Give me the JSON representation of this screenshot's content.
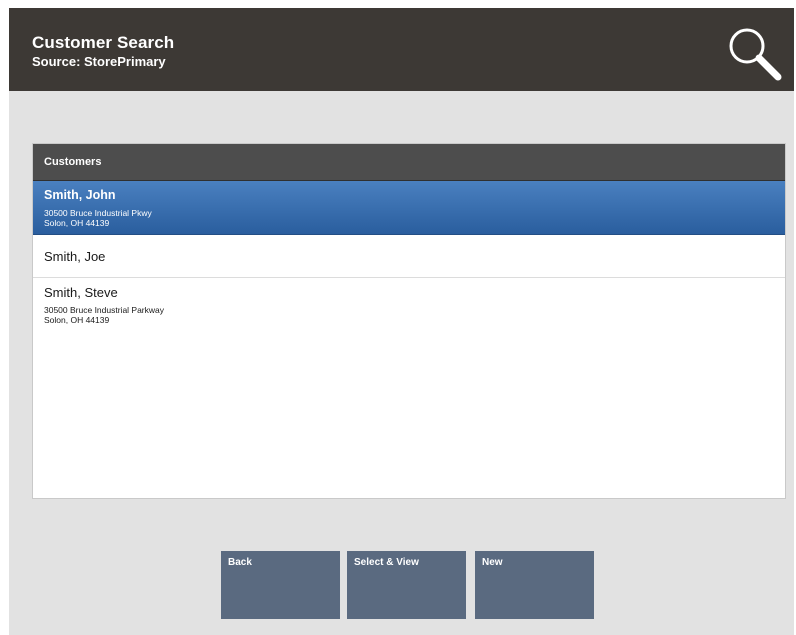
{
  "header": {
    "title": "Customer Search",
    "subtitle": "Source: StorePrimary",
    "icon": "search-icon"
  },
  "list": {
    "header": "Customers",
    "items": [
      {
        "name": "Smith, John",
        "address_line1": "30500 Bruce Industrial Pkwy",
        "address_line2": "Solon, OH 44139",
        "selected": true
      },
      {
        "name": "Smith, Joe",
        "address_line1": "",
        "address_line2": "",
        "selected": false
      },
      {
        "name": "Smith, Steve",
        "address_line1": "30500 Bruce Industrial Parkway",
        "address_line2": "Solon, OH 44139",
        "selected": false
      }
    ]
  },
  "buttons": {
    "back": "Back",
    "select_view": "Select & View",
    "new": "New"
  },
  "colors": {
    "header_bg": "#3d3935",
    "background": "#e2e2e2",
    "list_header_bg": "#4d4d4d",
    "selected_row": "#3a6fb0",
    "button_bg": "#5a6a80"
  }
}
